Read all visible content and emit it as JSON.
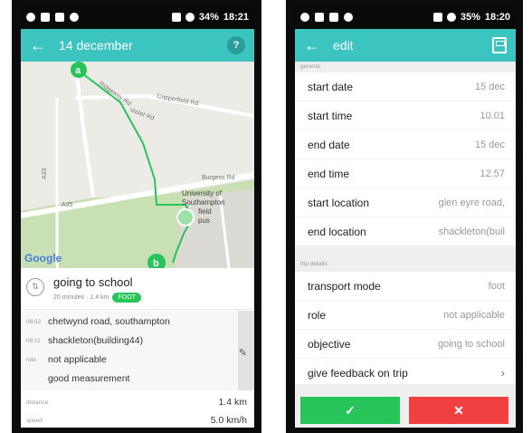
{
  "left": {
    "status": {
      "battery": "34%",
      "time": "18:21"
    },
    "appbar": {
      "title": "14 december",
      "help": "?"
    },
    "map": {
      "roads": [
        "Copperfield Rd",
        "Violet Rd",
        "Burgess Rd",
        "A35",
        "A33",
        "Ridgeway Rd"
      ],
      "campus": [
        "University of",
        "Southampton",
        "field",
        "pus"
      ],
      "start_marker": "a",
      "end_marker": "b",
      "google": "Google"
    },
    "trip": {
      "name": "going to school",
      "meta": "20 minutes · 1.4 km",
      "badge": "FOOT",
      "rows": [
        {
          "time": "08:52",
          "text": "chetwynd road, southampton"
        },
        {
          "time": "09:11",
          "text": "shackleton(building44)"
        },
        {
          "time": "role",
          "text": "not applicable"
        },
        {
          "time": "",
          "text": "good measurement"
        }
      ],
      "stats": [
        {
          "key": "distance",
          "value": "1.4 km"
        },
        {
          "key": "speed",
          "value": "5.0 km/h"
        }
      ]
    }
  },
  "right": {
    "status": {
      "battery": "35%",
      "time": "18:20"
    },
    "appbar": {
      "title": "edit"
    },
    "sections": {
      "general": "general",
      "trip_details": "trip details"
    },
    "general_fields": [
      {
        "label": "start date",
        "value": "15 dec"
      },
      {
        "label": "start time",
        "value": "10.01"
      },
      {
        "label": "end date",
        "value": "15 dec"
      },
      {
        "label": "end time",
        "value": "12.57"
      },
      {
        "label": "start location",
        "value": "glen eyre road,"
      },
      {
        "label": "end location",
        "value": "shackleton(buil"
      }
    ],
    "trip_fields": [
      {
        "label": "transport mode",
        "value": "foot"
      },
      {
        "label": "role",
        "value": "not applicable"
      },
      {
        "label": "objective",
        "value": "going to school"
      },
      {
        "label": "give feedback on trip",
        "value": ""
      }
    ],
    "buttons": {
      "ok": "✓",
      "cancel": "✕"
    }
  },
  "colors": {
    "accent": "#3cc4c0",
    "route": "#27c45a",
    "ok": "#27c45a",
    "cancel": "#f04040"
  },
  "icons": [
    "back-arrow-icon",
    "help-icon",
    "save-icon",
    "walk-icon",
    "pencil-icon",
    "chevron-right-icon",
    "check-icon",
    "close-icon"
  ]
}
